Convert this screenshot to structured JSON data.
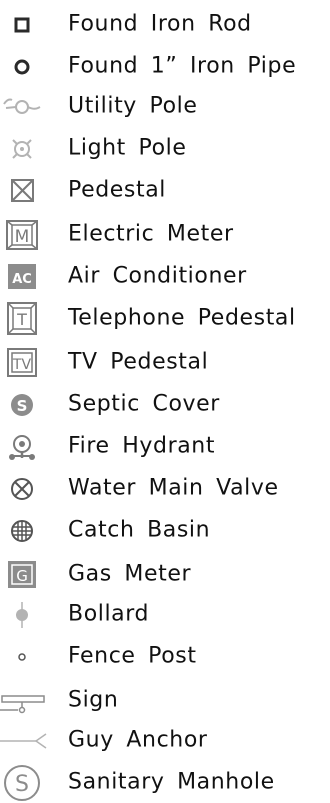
{
  "legend": {
    "items": [
      {
        "icon": "found-iron-rod-icon",
        "label": "Found Iron Rod"
      },
      {
        "icon": "found-iron-pipe-icon",
        "label": "Found 1” Iron Pipe"
      },
      {
        "icon": "utility-pole-icon",
        "label": "Utility Pole"
      },
      {
        "icon": "light-pole-icon",
        "label": "Light Pole"
      },
      {
        "icon": "pedestal-icon",
        "label": "Pedestal"
      },
      {
        "icon": "electric-meter-icon",
        "label": "Electric Meter",
        "glyph": "M"
      },
      {
        "icon": "air-conditioner-icon",
        "label": "Air Conditioner",
        "glyph": "AC"
      },
      {
        "icon": "telephone-pedestal-icon",
        "label": "Telephone Pedestal",
        "glyph": "T"
      },
      {
        "icon": "tv-pedestal-icon",
        "label": "TV Pedestal",
        "glyph": "TV"
      },
      {
        "icon": "septic-cover-icon",
        "label": "Septic Cover",
        "glyph": "S"
      },
      {
        "icon": "fire-hydrant-icon",
        "label": "Fire Hydrant"
      },
      {
        "icon": "water-main-valve-icon",
        "label": "Water Main Valve"
      },
      {
        "icon": "catch-basin-icon",
        "label": "Catch Basin"
      },
      {
        "icon": "gas-meter-icon",
        "label": "Gas Meter",
        "glyph": "G"
      },
      {
        "icon": "bollard-icon",
        "label": "Bollard"
      },
      {
        "icon": "fence-post-icon",
        "label": "Fence Post"
      },
      {
        "icon": "sign-icon",
        "label": "Sign"
      },
      {
        "icon": "guy-anchor-icon",
        "label": "Guy Anchor"
      },
      {
        "icon": "sanitary-manhole-icon",
        "label": "Sanitary Manhole",
        "glyph": "S"
      }
    ]
  },
  "colors": {
    "dark": "#2a2a2a",
    "gray": "#8c8c8c",
    "light_gray": "#b3b3b3",
    "text": "#111111"
  }
}
